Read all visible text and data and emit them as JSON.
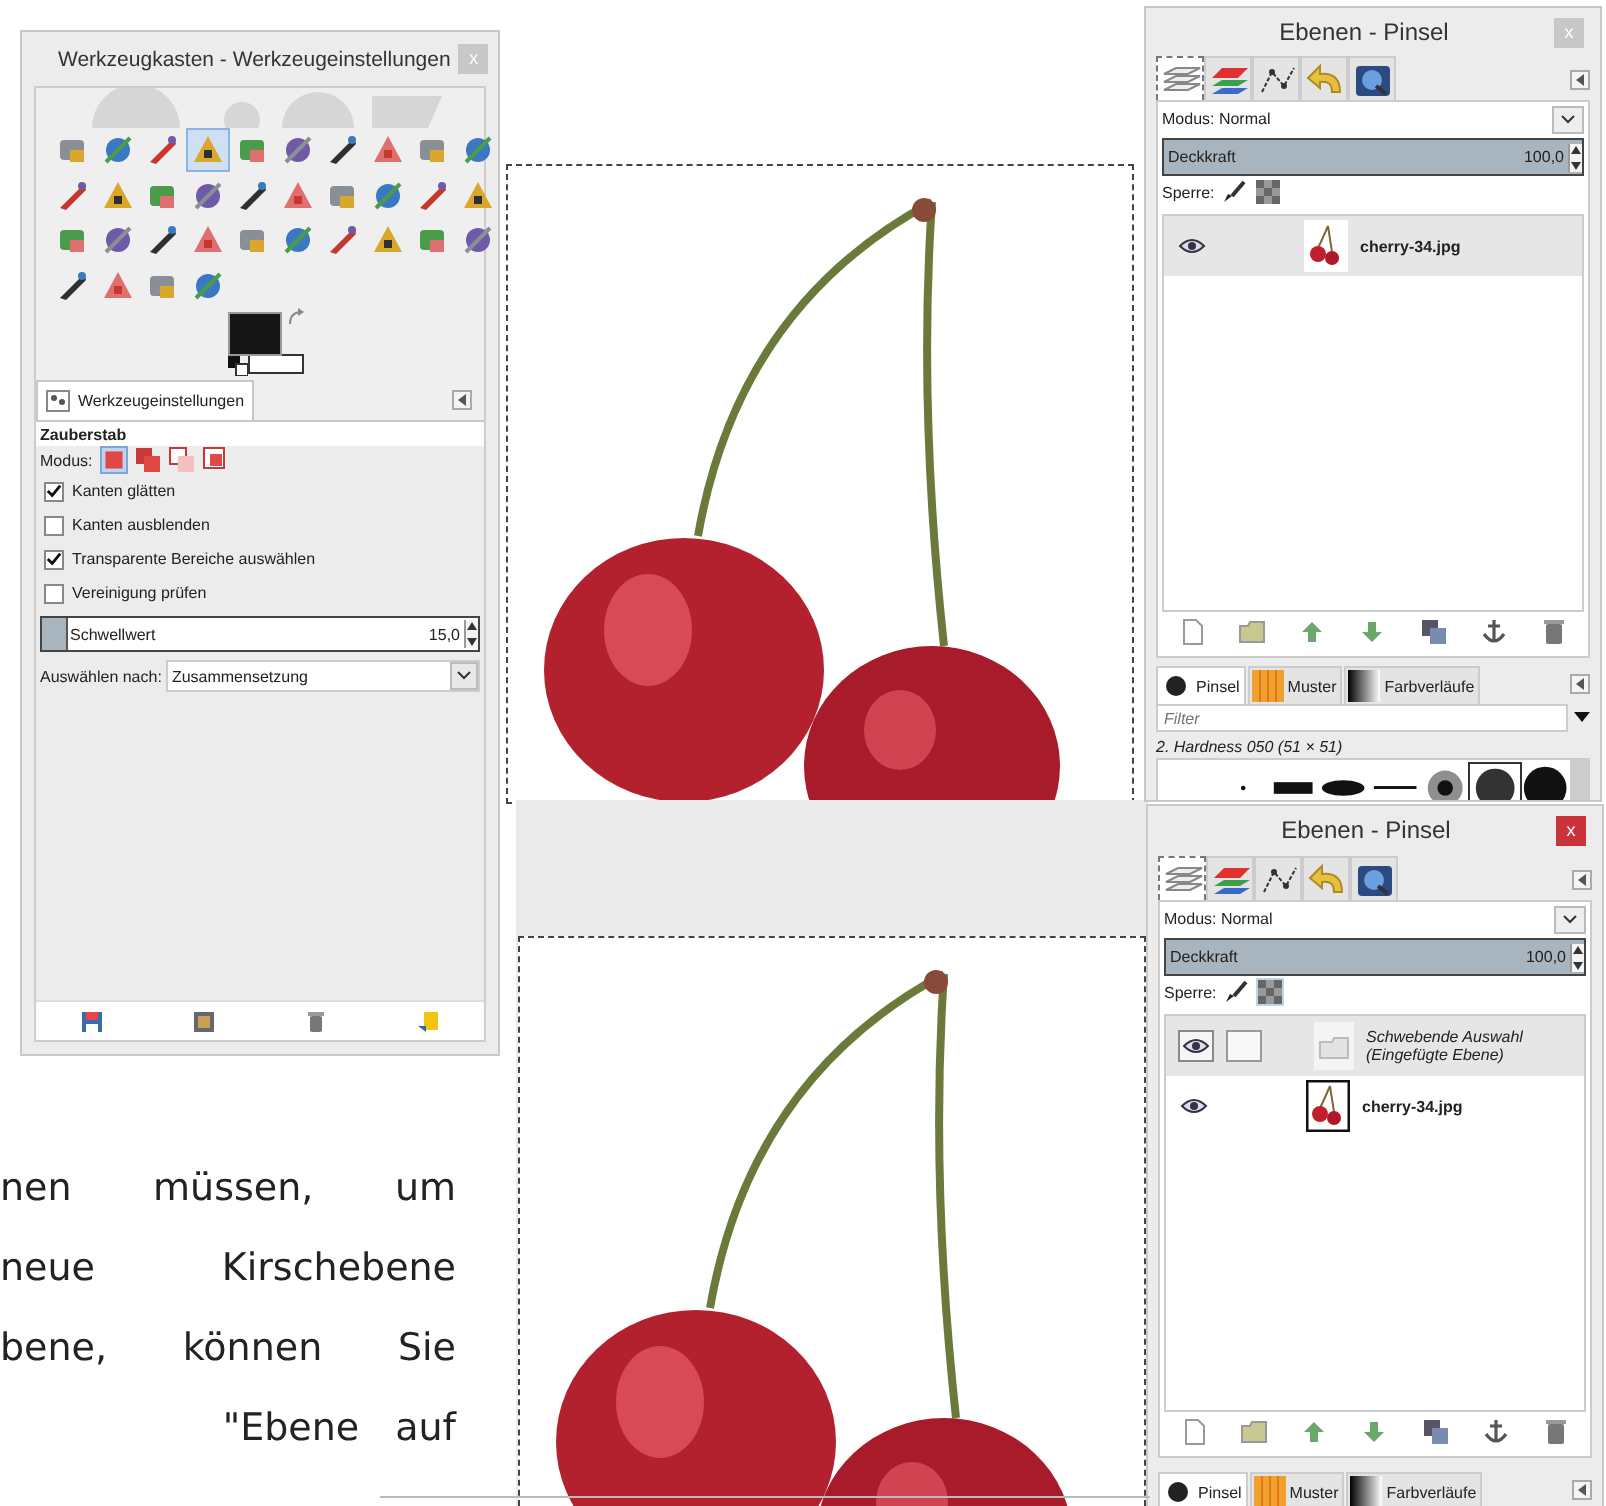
{
  "toolbox": {
    "title": "Werkzeugkasten - Werkzeugeinstellungen",
    "close": "x",
    "active": false,
    "tools": [
      {
        "selected": false
      },
      {
        "selected": false
      },
      {
        "selected": false
      },
      {
        "selected": true
      },
      {
        "selected": false
      },
      {
        "selected": false
      },
      {
        "selected": false
      },
      {
        "selected": false
      },
      {
        "selected": false
      },
      {
        "selected": false
      },
      {
        "selected": false
      },
      {
        "selected": false
      },
      {
        "selected": false
      },
      {
        "selected": false
      },
      {
        "selected": false
      },
      {
        "selected": false
      },
      {
        "selected": false
      },
      {
        "selected": false
      },
      {
        "selected": false
      },
      {
        "selected": false
      },
      {
        "selected": false
      },
      {
        "selected": false
      },
      {
        "selected": false
      },
      {
        "selected": false
      },
      {
        "selected": false
      },
      {
        "selected": false
      },
      {
        "selected": false
      },
      {
        "selected": false
      },
      {
        "selected": false
      },
      {
        "selected": false
      },
      {
        "selected": false
      },
      {
        "selected": false
      },
      {
        "selected": false
      },
      {
        "selected": false
      }
    ],
    "options_tab": "Werkzeugeinstellungen",
    "tool_name": "Zauberstab",
    "mode_label": "Modus:",
    "modes": [
      {
        "selected": true
      },
      {
        "selected": false
      },
      {
        "selected": false
      },
      {
        "selected": false
      }
    ],
    "checkboxes": [
      {
        "label": "Kanten glätten",
        "checked": true
      },
      {
        "label": "Kanten ausblenden",
        "checked": false
      },
      {
        "label": "Transparente Bereiche auswählen",
        "checked": true
      },
      {
        "label": "Vereinigung prüfen",
        "checked": false
      }
    ],
    "threshold": {
      "label": "Schwellwert",
      "value": "15,0",
      "level": 0.06
    },
    "select_by": {
      "label": "Auswählen nach:",
      "value": "Zusammensetzung"
    }
  },
  "layers_top": {
    "title": "Ebenen - Pinsel",
    "close": "x",
    "active": false,
    "tabs": [
      {
        "kind": "layers",
        "selected": true
      },
      {
        "kind": "channels",
        "selected": false
      },
      {
        "kind": "paths",
        "selected": false
      },
      {
        "kind": "undo",
        "selected": false
      },
      {
        "kind": "help",
        "selected": false
      }
    ],
    "mode": "Modus: Normal",
    "opacity": {
      "label": "Deckkraft",
      "value": "100,0",
      "level": 1
    },
    "lock_label": "Sperre:",
    "lock_alpha": false,
    "layers": [
      {
        "kind": "image",
        "name": "cherry-34.jpg",
        "selected": true,
        "active": false
      }
    ],
    "brush_tabs": [
      {
        "label": "Pinsel",
        "selected": true
      },
      {
        "label": "Muster",
        "selected": false
      },
      {
        "label": "Farbverläufe",
        "selected": false
      }
    ],
    "filter_placeholder": "Filter",
    "brush_name": "2. Hardness 050 (51 × 51)"
  },
  "layers_bottom": {
    "title": "Ebenen - Pinsel",
    "close": "x",
    "active": true,
    "tabs": [
      {
        "kind": "layers",
        "selected": true
      },
      {
        "kind": "channels",
        "selected": false
      },
      {
        "kind": "paths",
        "selected": false
      },
      {
        "kind": "undo",
        "selected": false
      },
      {
        "kind": "help",
        "selected": false
      }
    ],
    "mode": "Modus: Normal",
    "opacity": {
      "label": "Deckkraft",
      "value": "100,0",
      "level": 1
    },
    "lock_label": "Sperre:",
    "lock_alpha": true,
    "layers": [
      {
        "kind": "floating",
        "name": "Schwebende Auswahl",
        "note": "(Eingefügte Ebene)",
        "selected": true,
        "active": false
      },
      {
        "kind": "image",
        "name": "cherry-34.jpg",
        "selected": false,
        "active": true
      }
    ],
    "brush_tabs": [
      {
        "label": "Pinsel",
        "selected": true
      },
      {
        "label": "Muster",
        "selected": false
      },
      {
        "label": "Farbverläufe",
        "selected": false
      }
    ]
  },
  "text_lines": [
    "nen müssen, um",
    "neue Kirschebene",
    "bene, können Sie",
    "\"Ebene auf"
  ]
}
